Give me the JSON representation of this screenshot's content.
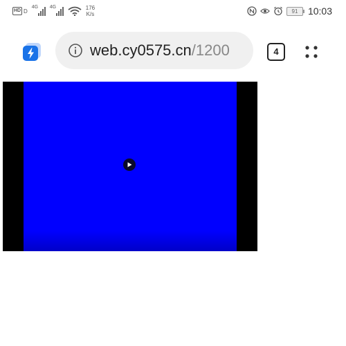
{
  "status_bar": {
    "hd_label": "HD",
    "hd_suffix": "D",
    "network_gen_1": "4G",
    "network_gen_2": "4G",
    "speed_value": "176",
    "speed_unit": "K/s",
    "battery_level": "91",
    "time": "10:03",
    "icons": [
      "hd-icon",
      "signal-icon",
      "signal-icon",
      "wifi-icon",
      "nfc-icon",
      "eye-icon",
      "alarm-icon",
      "battery-icon"
    ]
  },
  "toolbar": {
    "url_host": "web.cy0575.cn",
    "url_path": "/1200",
    "tab_count": "4",
    "icons": [
      "lightning-app-icon",
      "info-icon",
      "tabs-icon",
      "more-menu-icon"
    ]
  },
  "video": {
    "frame_color": "#0000ff",
    "letterbox_color": "#000000",
    "icons": [
      "play-icon"
    ]
  }
}
